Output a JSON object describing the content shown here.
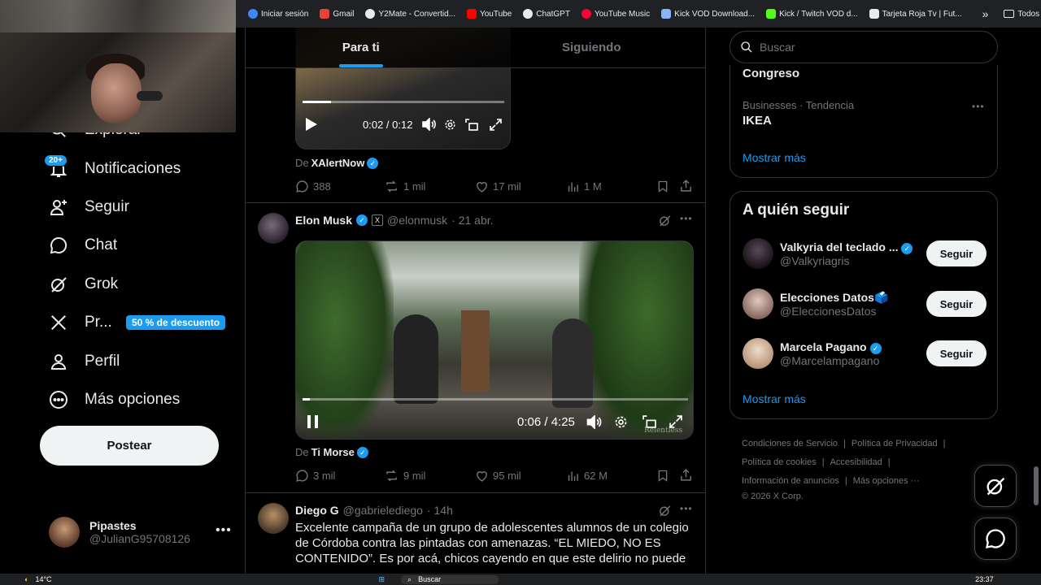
{
  "bookmarks": {
    "items": [
      {
        "label": "Iniciar sesión",
        "color": "#4285f4"
      },
      {
        "label": "Gmail",
        "color": "#ea4335"
      },
      {
        "label": "Y2Mate - Convertid...",
        "color": "#e8eaed"
      },
      {
        "label": "YouTube",
        "color": "#ff0000"
      },
      {
        "label": "ChatGPT",
        "color": "#e8eaed"
      },
      {
        "label": "YouTube Music",
        "color": "#ff0033"
      },
      {
        "label": "Kick VOD Download...",
        "color": "#8ab4f8"
      },
      {
        "label": "Kick / Twitch VOD d...",
        "color": "#53fc18"
      },
      {
        "label": "Tarjeta Roja Tv | Fut...",
        "color": "#e8eaed"
      }
    ],
    "all_bookmarks": "Todos los marcadores"
  },
  "nav": {
    "explore": "Explorar",
    "notifications": "Notificaciones",
    "notifications_badge": "20+",
    "follow": "Seguir",
    "chat": "Chat",
    "grok": "Grok",
    "premium": "Pr...",
    "premium_badge": "50 % de descuento",
    "profile": "Perfil",
    "more": "Más opciones",
    "post_button": "Postear"
  },
  "account": {
    "name": "Pipastes",
    "handle": "@JulianG95708126"
  },
  "tabs": {
    "for_you": "Para ti",
    "following": "Siguiendo"
  },
  "tweet1": {
    "video_time": "0:02 / 0:12",
    "progress": 0.14,
    "source_prefix": "De",
    "source_name": "XAlertNow",
    "replies": "388",
    "reposts": "1 mil",
    "likes": "17 mil",
    "views": "1 M"
  },
  "tweet2": {
    "name": "Elon Musk",
    "handle": "@elonmusk",
    "date": "· 21 abr.",
    "video_time": "0:06 / 4:25",
    "progress": 0.02,
    "watermark": "Relentless",
    "source_prefix": "De",
    "source_name": "Ti Morse",
    "replies": "3 mil",
    "reposts": "9 mil",
    "likes": "95 mil",
    "views": "62 M"
  },
  "tweet3": {
    "name": "Diego G",
    "handle": "@gabrielediego",
    "date": "· 14h",
    "text": "Excelente campaña de un grupo de adolescentes alumnos de un colegio de Córdoba contra las pintadas con amenazas. “EL MIEDO, NO ES CONTENIDO”. Es por acá, chicos cayendo en que este delirio no puede"
  },
  "search": {
    "placeholder": "Buscar"
  },
  "trends": {
    "item0": "Congreso",
    "item1_meta": "Businesses · Tendencia",
    "item1_name": "IKEA",
    "show_more": "Mostrar más"
  },
  "who_to_follow": {
    "title": "A quién seguir",
    "users": [
      {
        "name": "Valkyria del teclado ...",
        "handle": "@Valkyriagris",
        "button": "Seguir"
      },
      {
        "name": "Elecciones Datos🗳️",
        "handle": "@EleccionesDatos",
        "button": "Seguir"
      },
      {
        "name": "Marcela Pagano",
        "handle": "@Marcelampagano",
        "button": "Seguir"
      }
    ],
    "show_more": "Mostrar más"
  },
  "footer": {
    "terms": "Condiciones de Servicio",
    "privacy": "Política de Privacidad",
    "cookies": "Política de cookies",
    "accessibility": "Accesibilidad",
    "ads": "Información de anuncios",
    "more": "Más opciones ···",
    "copyright": "© 2026 X Corp."
  },
  "taskbar": {
    "weather": "14°C",
    "search": "Buscar",
    "time": "23:37"
  }
}
